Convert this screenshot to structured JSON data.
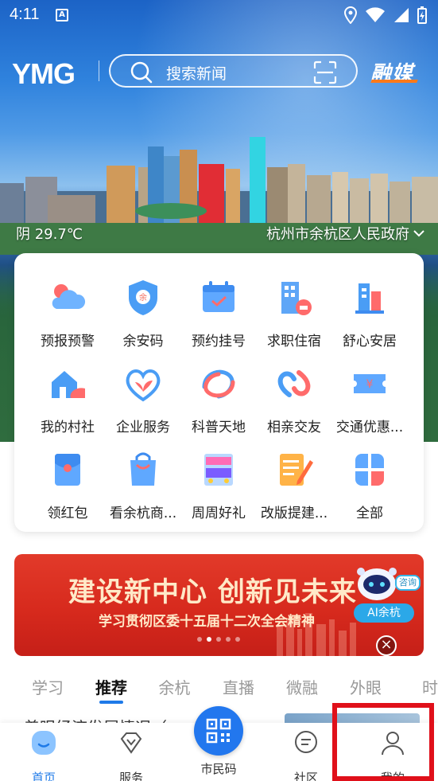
{
  "status_bar": {
    "time": "4:11",
    "app_badge": "A"
  },
  "header": {
    "brand": "YMG",
    "search_placeholder": "搜索新闻",
    "partner_logo": "融媒"
  },
  "weather": {
    "text": "阴 29.7℃"
  },
  "location": {
    "text": "杭州市余杭区人民政府"
  },
  "services": [
    {
      "label": "预报预警",
      "icon": "weather-cloud-icon"
    },
    {
      "label": "余安码",
      "icon": "shield-code-icon"
    },
    {
      "label": "预约挂号",
      "icon": "calendar-check-icon"
    },
    {
      "label": "求职住宿",
      "icon": "building-bed-icon"
    },
    {
      "label": "舒心安居",
      "icon": "housing-bars-icon"
    },
    {
      "label": "我的村社",
      "icon": "village-house-icon"
    },
    {
      "label": "企业服务",
      "icon": "heart-sprout-icon"
    },
    {
      "label": "科普天地",
      "icon": "ribbon-icon"
    },
    {
      "label": "相亲交友",
      "icon": "linked-hearts-icon"
    },
    {
      "label": "交通优惠...",
      "icon": "ticket-yen-icon"
    },
    {
      "label": "领红包",
      "icon": "red-packet-icon"
    },
    {
      "label": "看余杭商...",
      "icon": "shopping-bag-icon"
    },
    {
      "label": "周周好礼",
      "icon": "gift-poster-icon"
    },
    {
      "label": "改版提建...",
      "icon": "notepad-pencil-icon"
    },
    {
      "label": "全部",
      "icon": "grid-all-icon"
    }
  ],
  "banner": {
    "title": "建设新中心 创新见未来",
    "subtitle": "学习贯彻区委十五届十二次全会精神",
    "ai_label": "AI余杭",
    "ai_consult": "咨询",
    "close": "×"
  },
  "tabs": [
    "学习",
    "推荐",
    "余杭",
    "直播",
    "微融",
    "外眼",
    "时"
  ],
  "news_peek": {
    "text": "着眼经济发展情况（"
  },
  "bottom_nav": {
    "home": "首页",
    "service": "服务",
    "citizen_code": "市民码",
    "community": "社区",
    "mine": "我的"
  },
  "colors": {
    "accent": "#1e7ae8",
    "banner_red": "#d72a1d",
    "highlight": "#e0101a"
  }
}
